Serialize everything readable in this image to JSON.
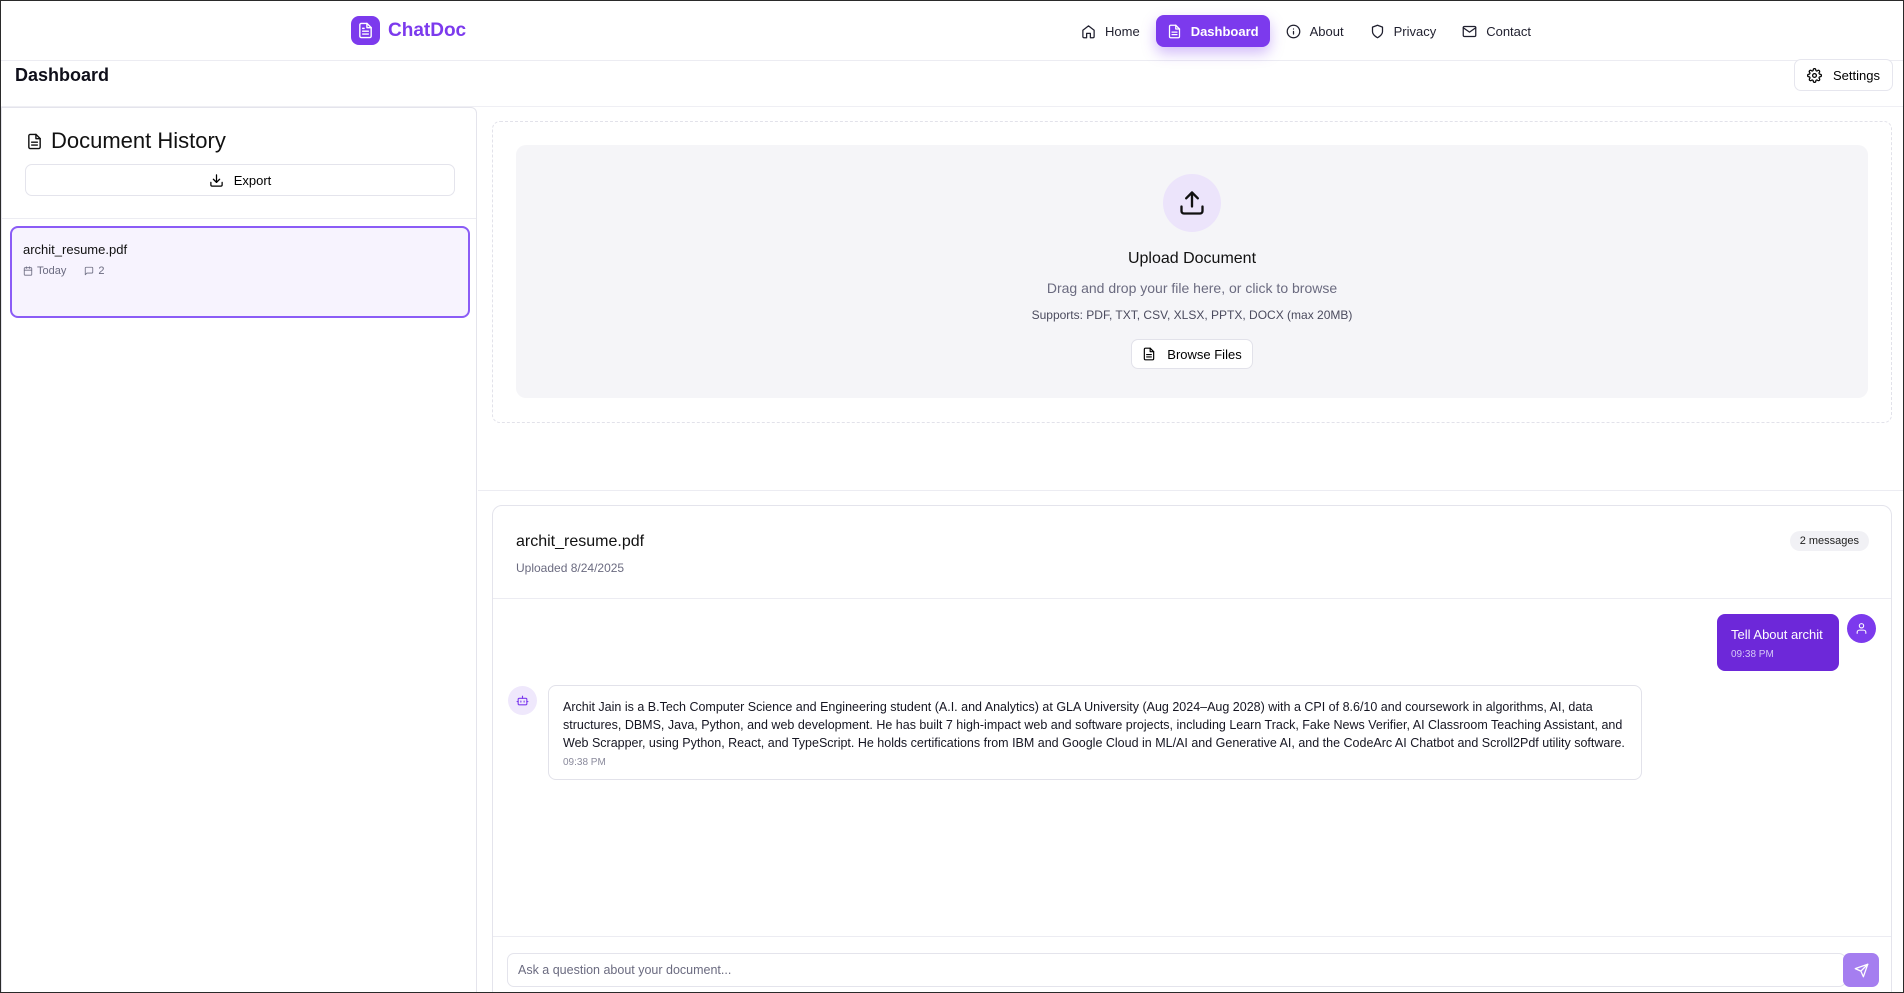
{
  "brand": {
    "name": "ChatDoc",
    "color": "#7c3aed"
  },
  "nav": {
    "items": [
      {
        "label": "Home",
        "icon": "home-icon",
        "active": false
      },
      {
        "label": "Dashboard",
        "icon": "document-icon",
        "active": true
      },
      {
        "label": "About",
        "icon": "info-icon",
        "active": false
      },
      {
        "label": "Privacy",
        "icon": "shield-icon",
        "active": false
      },
      {
        "label": "Contact",
        "icon": "mail-icon",
        "active": false
      }
    ]
  },
  "page": {
    "title": "Dashboard",
    "settings_label": "Settings"
  },
  "sidebar": {
    "title": "Document History",
    "export_label": "Export",
    "documents": [
      {
        "name": "archit_resume.pdf",
        "date": "Today",
        "message_count": "2",
        "selected": true
      }
    ]
  },
  "upload": {
    "title": "Upload Document",
    "subtitle": "Drag and drop your file here, or click to browse",
    "supports": "Supports: PDF, TXT, CSV, XLSX, PPTX, DOCX (max 20MB)",
    "browse_label": "Browse Files"
  },
  "chat": {
    "document_name": "archit_resume.pdf",
    "uploaded": "Uploaded 8/24/2025",
    "message_count_label": "2 messages",
    "messages": [
      {
        "role": "user",
        "text": "Tell About archit",
        "time": "09:38 PM"
      },
      {
        "role": "assistant",
        "text": "Archit Jain is a B.Tech Computer Science and Engineering student (A.I. and Analytics) at GLA University (Aug 2024–Aug 2028) with a CPI of 8.6/10 and coursework in algorithms, AI, data structures, DBMS, Java, Python, and web development. He has built 7 high-impact web and software projects, including Learn Track, Fake News Verifier, AI Classroom Teaching Assistant, and Web Scrapper, using Python, React, and TypeScript. He holds certifications from IBM and Google Cloud in ML/AI and Generative AI, and the CodeArc AI Chatbot and Scroll2Pdf utility software.",
        "time": "09:38 PM"
      }
    ],
    "input_placeholder": "Ask a question about your document...",
    "input_value": ""
  },
  "colors": {
    "accent": "#7c3aed",
    "user_bubble": "#6d28d9",
    "send_button": "#a57ef0",
    "selected_card_bg": "#f7f3fe"
  }
}
